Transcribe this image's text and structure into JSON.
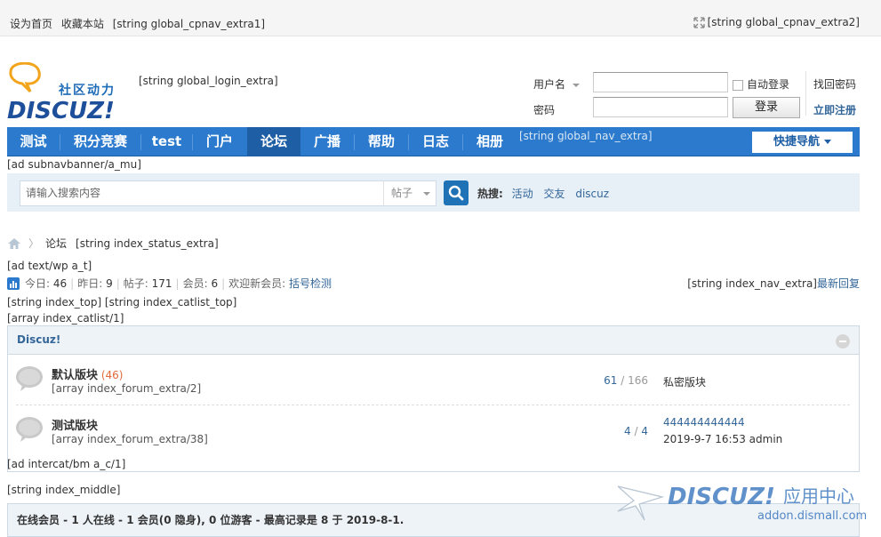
{
  "topbar": {
    "set_home": "设为首页",
    "bookmark": "收藏本站",
    "extra1": "[string global_cpnav_extra1]",
    "extra2": "[string global_cpnav_extra2]"
  },
  "logo": {
    "tagline": "社区动力",
    "brand": "DISCUZ!"
  },
  "header": {
    "login_extra": "[string global_login_extra]",
    "username_label": "用户名",
    "password_label": "密码",
    "username_value": "",
    "password_value": "",
    "auto_login": "自动登录",
    "login_button": "登录",
    "forgot_password": "找回密码",
    "register": "立即注册"
  },
  "nav": {
    "items": [
      "测试",
      "积分竞赛",
      "test",
      "门户",
      "论坛",
      "广播",
      "帮助",
      "日志",
      "相册"
    ],
    "active_index": 4,
    "extra": "[string global_nav_extra]",
    "quick_nav": "快捷导航"
  },
  "ad_subnav": "[ad subnavbanner/a_mu]",
  "search": {
    "placeholder": "请输入搜索内容",
    "type": "帖子",
    "hot_label": "热搜:",
    "hot_items": [
      "活动",
      "交友",
      "discuz"
    ]
  },
  "breadcrumb": {
    "current": "论坛",
    "extra": "[string index_status_extra]"
  },
  "ad_text": "[ad text/wp a_t]",
  "stats": {
    "today_label": "今日:",
    "today": "46",
    "yesterday_label": "昨日:",
    "yesterday": "9",
    "posts_label": "帖子:",
    "posts": "171",
    "members_label": "会员:",
    "members": "6",
    "welcome_label": "欢迎新会员:",
    "new_member": "括号检测",
    "nav_extra": "[string index_nav_extra]",
    "latest_reply": "最新回复"
  },
  "index_top": "[string index_top] [string index_catlist_top]",
  "catlist": "[array index_catlist/1]",
  "category": {
    "title": "Discuz!"
  },
  "forums": [
    {
      "name": "默认版块",
      "today": "(46)",
      "extra": "[array index_forum_extra/2]",
      "threads": "61",
      "posts": "166",
      "last_line1": "私密版块",
      "last_line2": ""
    },
    {
      "name": "测试版块",
      "today": "",
      "extra": "[array index_forum_extra/38]",
      "threads": "4",
      "posts": "4",
      "last_line1": "444444444444",
      "last_line2": "2019-9-7 16:53 admin"
    }
  ],
  "ad_intercat": "[ad intercat/bm a_c/1]",
  "index_middle": "[string index_middle]",
  "online": "在线会员 - 1 人在线 - 1 会员(0 隐身), 0 位游客 - 最高记录是 8 于 2019-8-1.",
  "watermark": {
    "brand": "DISCUZ!",
    "suffix": "应用中心",
    "url": "addon.dismall.com"
  },
  "colors": {
    "nav_bg": "#2b7acd",
    "nav_active": "#1d5ea4",
    "link": "#336699",
    "accent_orange": "#e06a3c"
  }
}
